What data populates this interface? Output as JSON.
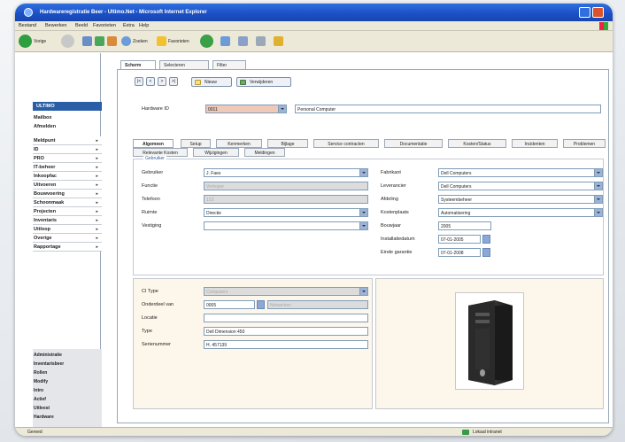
{
  "window": {
    "title": "Hardwareregistratie Beer - Ultimo.Net - Microsoft Internet Explorer"
  },
  "menu": {
    "items": [
      "Bestand",
      "Bewerken",
      "Beeld",
      "Favorieten",
      "Extra",
      "Help"
    ]
  },
  "toolbar": {
    "back_label": "Vorige",
    "search_label": "Zoeken",
    "favorites_label": "Favorieten"
  },
  "sidebar": {
    "logo": "ULTIMO",
    "top_links": [
      "Mailbox",
      "Afmelden"
    ],
    "nav_items": [
      "Meldpunt",
      "ID",
      "PRO",
      "IT-beheer",
      "Inkoopfac",
      "Uitvoeren",
      "Bouwvoering",
      "Schoonmaak",
      "Projecten",
      "Inventaris",
      "Uitloop",
      "Overige",
      "Rapportage"
    ],
    "bottom_items": [
      "Administratie",
      "Inventarisbeer",
      "Rollen",
      "Modify",
      "Intro",
      "Actief",
      "Uitleest",
      "Hardware"
    ]
  },
  "record": {
    "top_tabs": [
      "Scherm",
      "Selecteren",
      "Filter"
    ],
    "nav_buttons": [
      "|<",
      "<",
      ">",
      ">|"
    ],
    "action_buttons": [
      "Nieuw",
      "Verwijderen"
    ],
    "hardware_id_label": "Hardware ID",
    "hardware_id_value": "0011",
    "hardware_description": "Personal Computer"
  },
  "subtabs": {
    "row1": [
      "Algemeen",
      "Setup",
      "Kenmerken",
      "Bijlage",
      "Service contracten",
      "Documentatie",
      "Kosten/Status",
      "Incidenten",
      "Problemen"
    ],
    "row2": [
      "Relevante Kosten",
      "Wijzigingen",
      "Meldingen"
    ],
    "active": "Algemeen"
  },
  "general": {
    "legend": "Gebruiker",
    "left_fields": [
      {
        "label": "Gebruiker",
        "value": "J. Faes"
      },
      {
        "label": "Functie",
        "value": "Verkoper"
      },
      {
        "label": "Telefoon",
        "value": "123"
      },
      {
        "label": "Ruimte",
        "value": "Directie"
      },
      {
        "label": "Vestiging",
        "value": ""
      }
    ],
    "right_fields": [
      {
        "label": "Fabrikant",
        "value": "Dell Computers"
      },
      {
        "label": "Leverancier",
        "value": "Dell Computers"
      },
      {
        "label": "Afdeling",
        "value": "Systeembeheer"
      },
      {
        "label": "Kostenplaats",
        "value": "Automatisering"
      },
      {
        "label": "Bouwjaar",
        "value": "2005"
      },
      {
        "label": "Installatiedatum",
        "value": "07-01-2005"
      },
      {
        "label": "Einde garantie",
        "value": "07-01-2008"
      }
    ]
  },
  "config": {
    "ci_type_label": "CI Type",
    "ci_type_value": "Computers",
    "onderdeel_label": "Onderdeel van",
    "onderdeel_value": "0005",
    "onderdeel_desc": "Netwerken",
    "locatie_label": "Locatie",
    "locatie_value": "",
    "type_label": "Type",
    "type_value": "Dell Dimension 450",
    "serie_label": "Serienummer",
    "serie_value": "H. 457139"
  },
  "status": {
    "left": "Gereed",
    "right": "Lokaal intranet"
  },
  "colors": {
    "titlebar": "#1b4fc4",
    "highlight_field": "#f0c8b8",
    "panel_cream": "#fdf6ea"
  }
}
